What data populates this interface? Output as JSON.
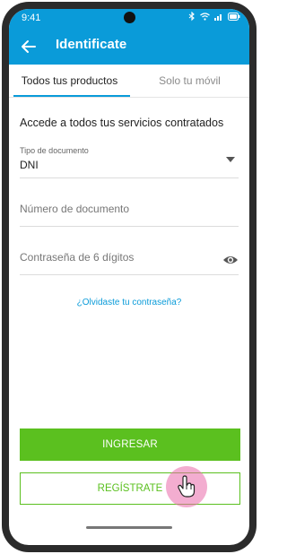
{
  "status_bar": {
    "time": "9:41"
  },
  "app_bar": {
    "title": "Identificate"
  },
  "tabs": [
    {
      "label": "Todos tus productos"
    },
    {
      "label": "Solo tu móvil"
    }
  ],
  "form": {
    "subtitle": "Accede a todos tus servicios contratados",
    "doc_type_label": "Tipo de documento",
    "doc_type_value": "DNI",
    "doc_number_placeholder": "Número de documento",
    "password_placeholder": "Contraseña de 6 dígitos",
    "forgot_link": "¿Olvidaste tu contraseña?"
  },
  "buttons": {
    "primary_label": "INGRESAR",
    "secondary_label": "REGÍSTRATE"
  },
  "colors": {
    "brand_blue": "#0a9bd9",
    "action_green": "#5bc01f",
    "tap_highlight": "#e969aa"
  },
  "icons": [
    "back-arrow-icon",
    "bluetooth-icon",
    "wifi-icon",
    "signal-icon",
    "battery-icon",
    "dropdown-caret-icon",
    "eye-icon",
    "hand-pointer-icon"
  ]
}
